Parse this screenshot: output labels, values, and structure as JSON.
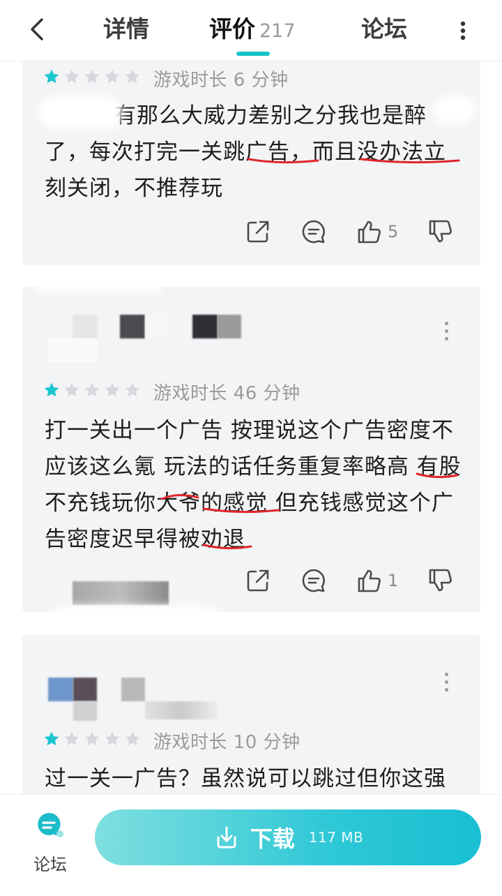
{
  "header": {
    "tabs": [
      {
        "label": "详情"
      },
      {
        "label": "评价",
        "count": "217"
      },
      {
        "label": "论坛"
      }
    ]
  },
  "reviews": [
    {
      "rating": 1,
      "playtime": "游戏时长 6 分钟",
      "text": "有那么大威力差别之分我也是醉了，每次打完一关跳广告，而且没办法立刻关闭，不推荐玩",
      "likes": "5"
    },
    {
      "rating": 1,
      "playtime": "游戏时长 46 分钟",
      "text": "打一关出一个广告 按理说这个广告密度不应该这么氪 玩法的话任务重复率略高 有股不充钱玩你大爷的感觉 但充钱感觉这个广告密度迟早得被劝退",
      "likes": "1"
    },
    {
      "rating": 1,
      "playtime": "游戏时长 10 分钟",
      "text": "过一关一广告？虽然说可以跳过但你这强"
    }
  ],
  "bottom_bar": {
    "forum_label": "论坛",
    "download_label": "下载",
    "download_size": "117 MB"
  },
  "colors": {
    "accent": "#14c3c8",
    "star_filled": "#1cc6cf",
    "star_empty": "#d6d8dc",
    "card_bg": "#f3f4f6",
    "annotation_red": "#e0242b"
  }
}
